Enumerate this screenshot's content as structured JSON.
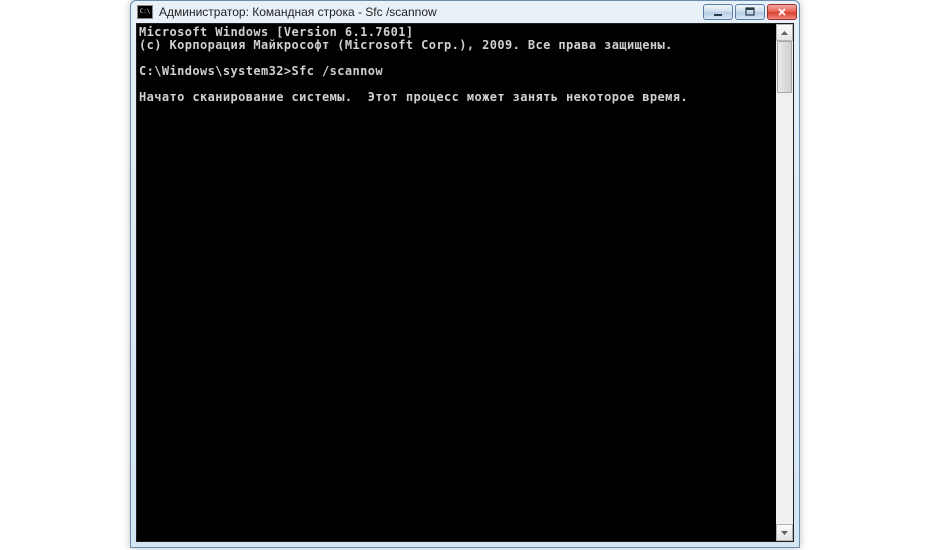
{
  "window": {
    "title": "Администратор: Командная строка - Sfc  /scannow"
  },
  "console": {
    "lines": [
      "Microsoft Windows [Version 6.1.7601]",
      "(c) Корпорация Майкрософт (Microsoft Corp.), 2009. Все права защищены.",
      "",
      "C:\\Windows\\system32>Sfc /scannow",
      "",
      "Начато сканирование системы.  Этот процесс может занять некоторое время."
    ]
  }
}
